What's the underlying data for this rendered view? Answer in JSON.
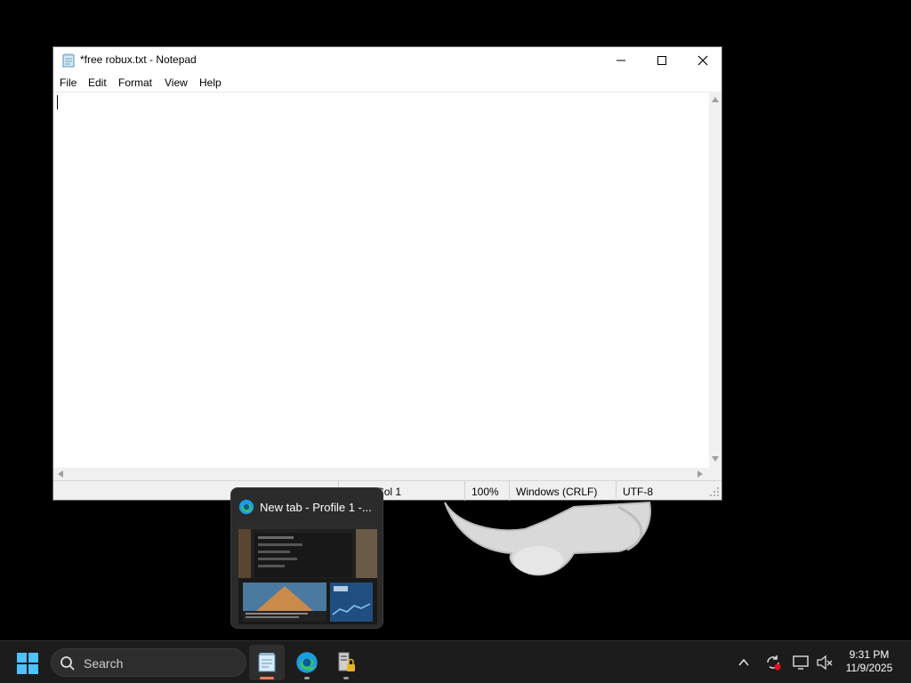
{
  "notepad": {
    "title": "*free robux.txt - Notepad",
    "menu": [
      "File",
      "Edit",
      "Format",
      "View",
      "Help"
    ],
    "content": "",
    "status": {
      "position": "Ln 1, Col 1",
      "zoom": "100%",
      "line_ending": "Windows (CRLF)",
      "encoding": "UTF-8"
    }
  },
  "preview": {
    "title": "New tab - Profile 1 -...",
    "icon": "edge-icon"
  },
  "taskbar": {
    "search_label": "Search",
    "apps": [
      {
        "name": "notepad",
        "icon": "notepad-icon",
        "active": true
      },
      {
        "name": "edge",
        "icon": "edge-icon",
        "active": false
      },
      {
        "name": "server-manager",
        "icon": "server-lock-icon",
        "active": false
      }
    ],
    "tray_icons": [
      "chevron-up-icon",
      "sync-icon",
      "display-icon",
      "volume-muted-icon"
    ],
    "clock": {
      "time": "9:31 PM",
      "date": "11/9/2025"
    }
  },
  "colors": {
    "accent": "#0078d4",
    "taskbar": "#1c1c1c",
    "notepad_indicator": "#f07c5a"
  }
}
